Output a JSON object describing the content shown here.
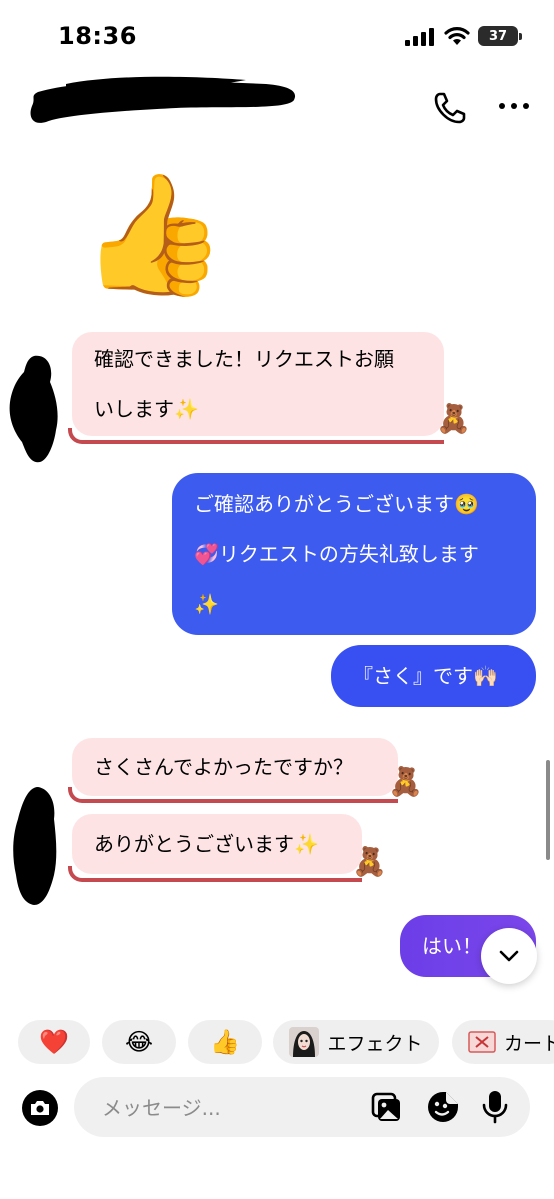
{
  "status": {
    "time": "18:36",
    "battery": "37"
  },
  "header": {
    "phone_icon": "phone-icon",
    "more_icon": "more-icon"
  },
  "messages": {
    "big_emoji": "👍",
    "m1_line1": "確認できました！リクエストお願",
    "m1_line2": "いします✨",
    "m2_line1": "ご確認ありがとうございます🥹",
    "m2_line2": "💞リクエストの方失礼致します",
    "m2_line3": "✨",
    "m3": "『さく』です🙌🏻",
    "m4": "さくさんでよかったですか？",
    "m5": "ありがとうございます✨",
    "m6": "はい！",
    "bear": "🧸"
  },
  "reactions": {
    "heart": "❤️",
    "laugh": "😂",
    "thumb": "👍",
    "effect_label": "エフェクト",
    "card_label": "カート"
  },
  "composer": {
    "placeholder": "メッセージ..."
  },
  "colors": {
    "sent": "#3e5bf0",
    "received": "#fde3e4",
    "received_accent": "#c44a4f"
  }
}
